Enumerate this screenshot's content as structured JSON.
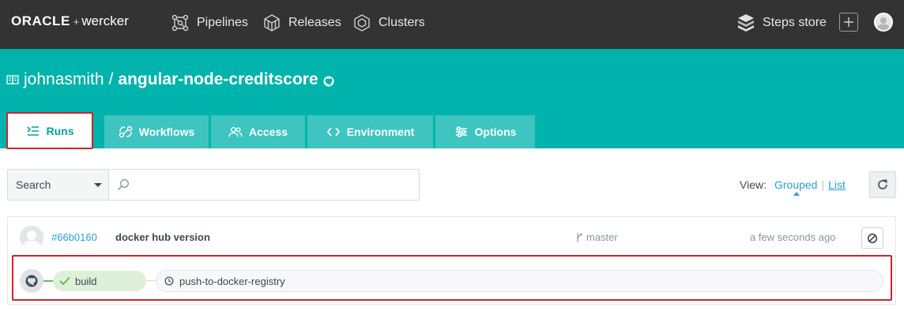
{
  "brand": {
    "oracle": "ORACLE",
    "plus": "+",
    "wercker": "wercker"
  },
  "topnav": {
    "items": [
      {
        "label": "Pipelines",
        "icon": "pipelines-icon"
      },
      {
        "label": "Releases",
        "icon": "releases-icon"
      },
      {
        "label": "Clusters",
        "icon": "clusters-icon"
      }
    ],
    "steps_store": "Steps store"
  },
  "repo": {
    "owner": "johnasmith",
    "separator": "/",
    "name": "angular-node-creditscore"
  },
  "tabs": [
    {
      "label": "Runs",
      "icon": "runs-icon",
      "active": true
    },
    {
      "label": "Workflows",
      "icon": "workflows-icon"
    },
    {
      "label": "Access",
      "icon": "access-icon"
    },
    {
      "label": "Environment",
      "icon": "code-icon"
    },
    {
      "label": "Options",
      "icon": "sliders-icon"
    }
  ],
  "search": {
    "select_value": "Search",
    "placeholder": ""
  },
  "view": {
    "label": "View:",
    "grouped": "Grouped",
    "separator": "|",
    "list": "List"
  },
  "run": {
    "hash": "#66b0160",
    "message": "docker hub version",
    "branch": "master",
    "time": "a few seconds ago",
    "pipeline": [
      {
        "name": "build",
        "status": "passed"
      },
      {
        "name": "push-to-docker-registry",
        "status": "pending"
      }
    ]
  },
  "colors": {
    "topbar": "#333333",
    "header_teal": "#00b3ad",
    "tab_teal": "#3ec5bf",
    "link": "#2a9fd6",
    "success": "#62bf53",
    "highlight": "#d0232b"
  }
}
